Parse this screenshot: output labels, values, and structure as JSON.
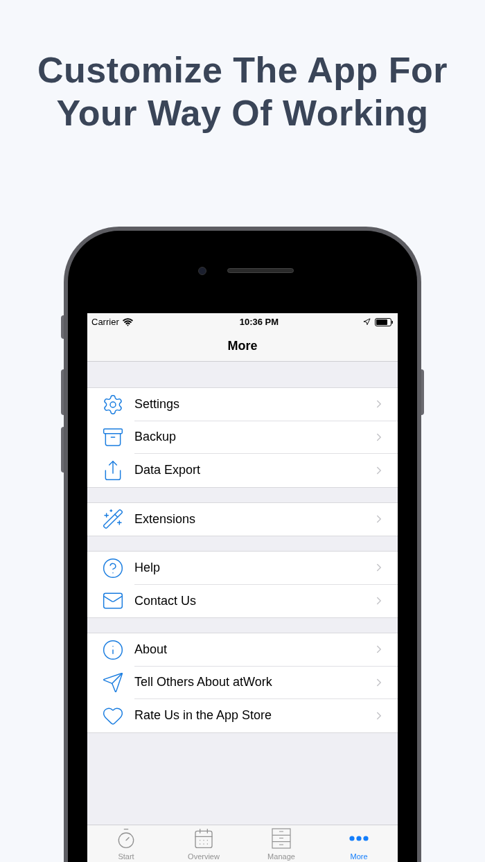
{
  "headline": [
    "Customize The App For",
    "Your Way Of Working"
  ],
  "status_bar": {
    "carrier": "Carrier",
    "time": "10:36 PM"
  },
  "nav": {
    "title": "More"
  },
  "sections": [
    {
      "items": [
        {
          "label": "Settings"
        },
        {
          "label": "Backup"
        },
        {
          "label": "Data Export"
        }
      ]
    },
    {
      "items": [
        {
          "label": "Extensions"
        }
      ]
    },
    {
      "items": [
        {
          "label": "Help"
        },
        {
          "label": "Contact Us"
        }
      ]
    },
    {
      "items": [
        {
          "label": "About"
        },
        {
          "label": "Tell Others About atWork"
        },
        {
          "label": "Rate Us in the App Store"
        }
      ]
    }
  ],
  "tab_bar": [
    {
      "label": "Start",
      "selected": false
    },
    {
      "label": "Overview",
      "selected": false
    },
    {
      "label": "Manage",
      "selected": false
    },
    {
      "label": "More",
      "selected": true
    }
  ]
}
